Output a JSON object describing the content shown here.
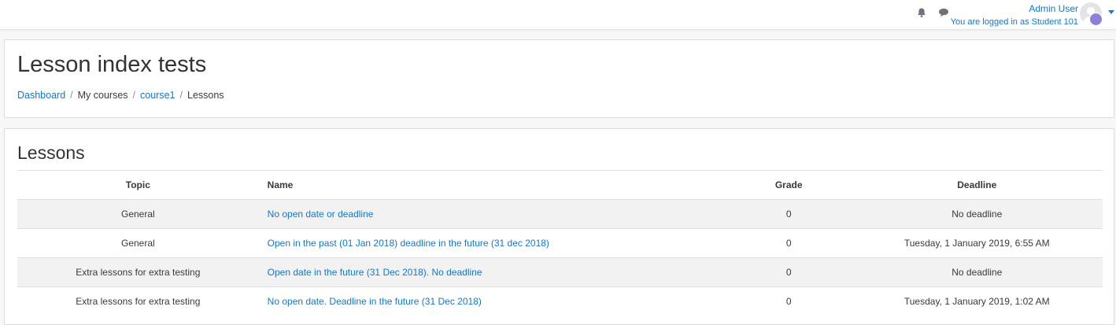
{
  "navbar": {
    "icons": [
      "bell-icon",
      "chat-icon"
    ],
    "user_name": "Admin User",
    "logged_in_as": "You are logged in as Student 101"
  },
  "header": {
    "title": "Lesson index tests",
    "breadcrumb": [
      "Dashboard",
      "My courses",
      "course1",
      "Lessons"
    ]
  },
  "main": {
    "section_title": "Lessons",
    "columns": [
      "Topic",
      "Name",
      "Grade",
      "Deadline"
    ],
    "rows": [
      {
        "topic": "General",
        "name": "No open date or deadline",
        "grade": "0",
        "deadline": "No deadline"
      },
      {
        "topic": "General",
        "name": "Open in the past (01 Jan 2018) deadline in the future (31 dec 2018)",
        "grade": "0",
        "deadline": "Tuesday, 1 January 2019, 6:55 AM"
      },
      {
        "topic": "Extra lessons for extra testing",
        "name": "Open date in the future (31 Dec 2018). No deadline",
        "grade": "0",
        "deadline": "No deadline"
      },
      {
        "topic": "Extra lessons for extra testing",
        "name": "No open date. Deadline in the future (31 Dec 2018)",
        "grade": "0",
        "deadline": "Tuesday, 1 January 2019, 1:02 AM"
      }
    ]
  },
  "colors": {
    "link": "#1177d1",
    "text": "#373a3c",
    "stripe": "#f2f2f2",
    "avatar_badge": "#8f7fd9"
  }
}
